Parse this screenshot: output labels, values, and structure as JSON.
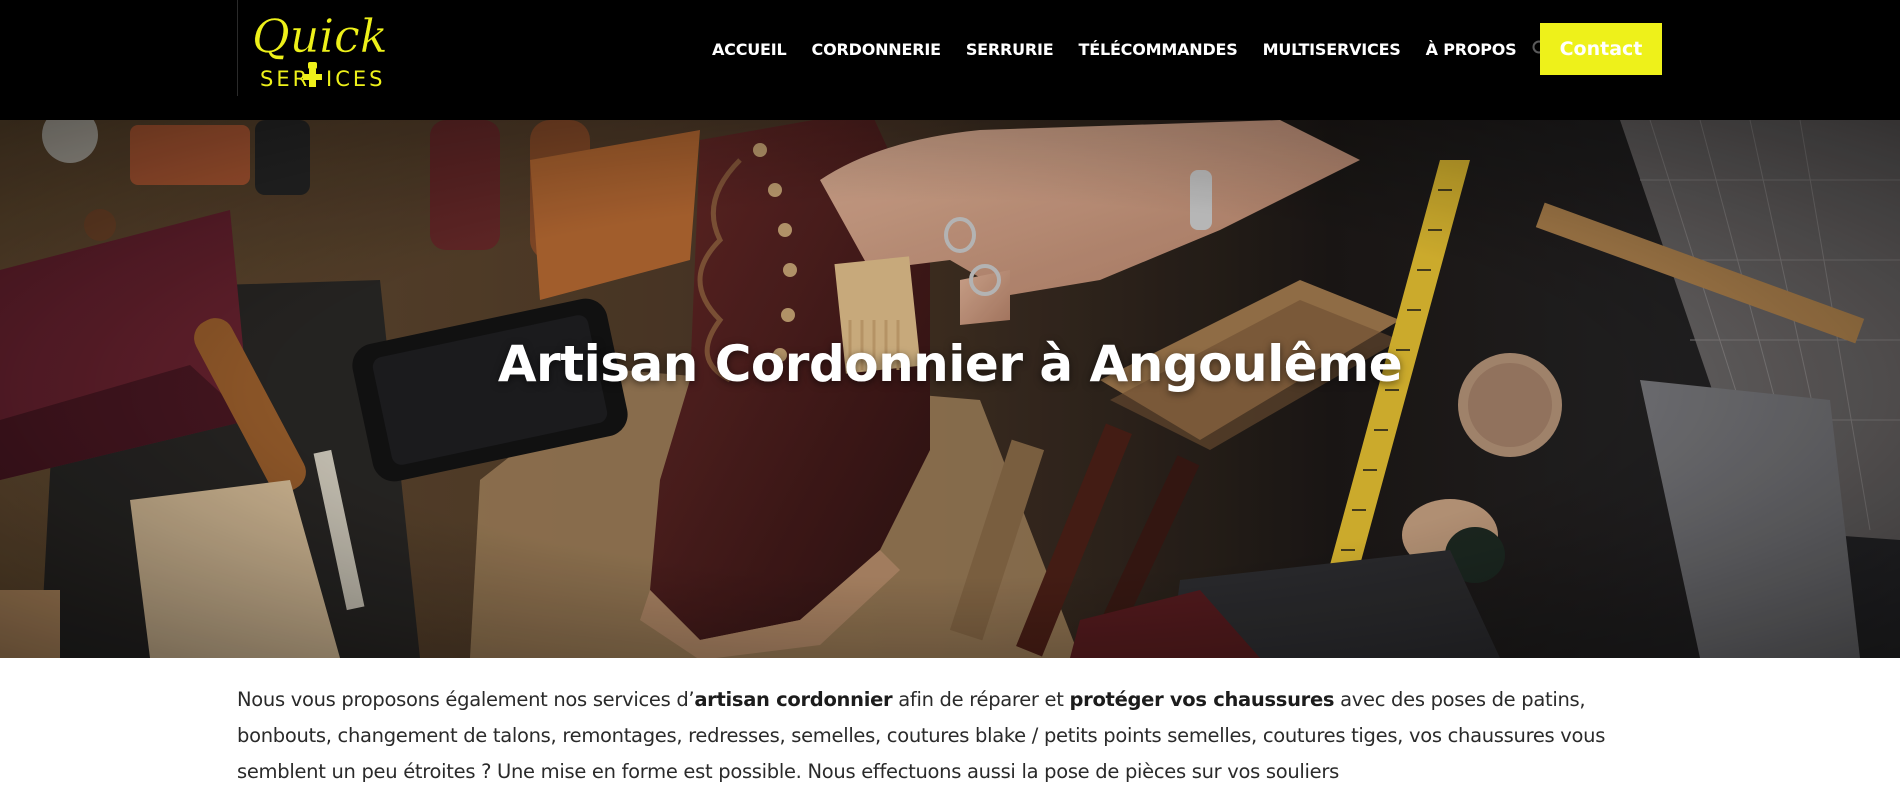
{
  "brand": {
    "logo_line1": "Quick",
    "logo_line2_a": "SER",
    "logo_line2_b": "ICES",
    "accent_color": "#eef11a"
  },
  "nav": {
    "items": [
      {
        "label": "ACCUEIL"
      },
      {
        "label": "CORDONNERIE"
      },
      {
        "label": "SERRURIE"
      },
      {
        "label": "TÉLÉCOMMANDES"
      },
      {
        "label": "MULTISERVICES"
      },
      {
        "label": "À PROPOS"
      }
    ],
    "search_icon": "search-icon",
    "contact_label": "Contact"
  },
  "hero": {
    "title": "Artisan Cordonnier à Angoulême"
  },
  "intro": {
    "t1": "Nous vous proposons également nos services d’",
    "b1": "artisan cordonnier",
    "t2": " afin de réparer et ",
    "b2": "protéger vos chaussures",
    "t3": " avec des poses de patins, bonbouts, changement de talons, remontages, redresses, semelles, coutures blake / petits points semelles, coutures tiges, vos chaussures vous semblent un peu étroites ? Une mise en forme est possible. Nous effectuons aussi la pose de pièces sur vos souliers"
  }
}
